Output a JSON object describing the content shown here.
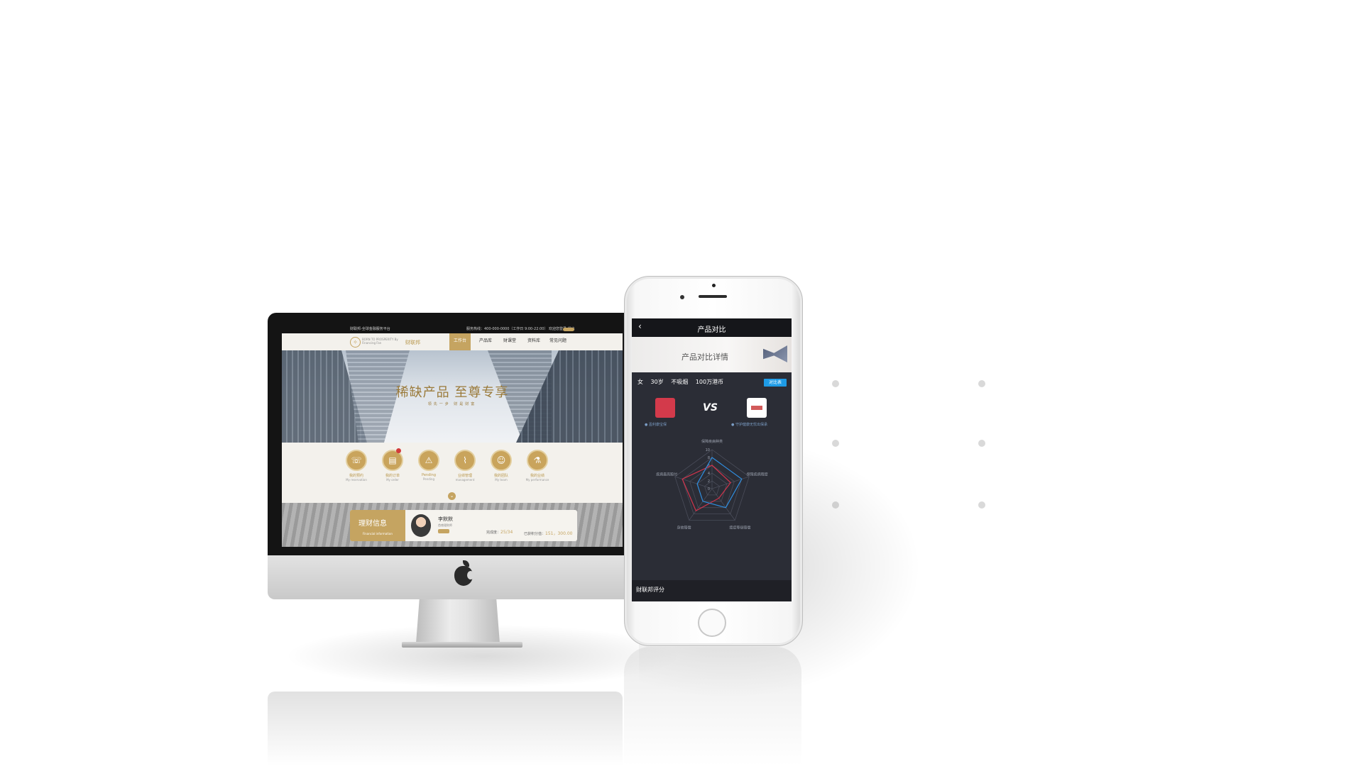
{
  "desktop_site": {
    "topbar": {
      "left_text": "财联邦-全球金融服务平台",
      "right_text": "服务热线：400-000-0000（工作日 9:00-22:00）   欢迎您登录   退出"
    },
    "brand": {
      "logo_glyph": "✧",
      "subtitle": "BORN TO PROSPERITY By Financing Fan",
      "name": "财联邦"
    },
    "nav": [
      {
        "label": "工作台",
        "active": true
      },
      {
        "label": "产品库",
        "active": false
      },
      {
        "label": "财课堂",
        "active": false
      },
      {
        "label": "资料库",
        "active": false
      },
      {
        "label": "常见问题",
        "active": false
      }
    ],
    "hero": {
      "title": "稀缺产品 至尊专享",
      "subtitle": "领先一步 财是财富"
    },
    "shortcuts": [
      {
        "icon": "reservation-icon",
        "glyph": "☏",
        "label": "我的预约",
        "sub": "My reservation"
      },
      {
        "icon": "order-icon",
        "glyph": "▤",
        "label": "我的订单",
        "sub": "My order"
      },
      {
        "icon": "warning-icon",
        "glyph": "⚠",
        "label": "Pending",
        "sub": "Pending"
      },
      {
        "icon": "chart-icon",
        "glyph": "⌇",
        "label": "业绩管理",
        "sub": "management"
      },
      {
        "icon": "team-icon",
        "glyph": "☺",
        "label": "我的团队",
        "sub": "My team"
      },
      {
        "icon": "performance-icon",
        "glyph": "⚗",
        "label": "我的业绩",
        "sub": "My performance"
      }
    ],
    "info_card": {
      "title": "理财信息",
      "title_en": "Financial information",
      "name": "李默默",
      "role": "首席理财师",
      "stat1_label": "完成度：",
      "stat1_value": "25/34",
      "stat2_label": "已获积分值：",
      "stat2_value": "151，300.00"
    }
  },
  "mobile_app": {
    "header": {
      "back": "‹",
      "title": "产品对比"
    },
    "banner": "产品对比详情",
    "filters": [
      "女",
      "30岁",
      "不吸烟",
      "100万港币"
    ],
    "compare_button": "对比表",
    "vs": "VS",
    "product_a": "● 盈利康宝保",
    "product_b": "● 守护健康无忧出保承",
    "score_title": "财联邦评分",
    "colors": {
      "series_a": "#d0344c",
      "series_b": "#2f8ee0"
    }
  },
  "chart_data": {
    "type": "radar",
    "categories": [
      "保障疾病种类",
      "保障疾病程度",
      "癌症等级赔偿",
      "身故赔偿",
      "疾病最高赔付"
    ],
    "ticks": [
      0,
      2,
      4,
      6,
      8,
      10
    ],
    "rlim": [
      0,
      10
    ],
    "series": [
      {
        "values": [
          6,
          5,
          3,
          7,
          8
        ]
      },
      {
        "values": [
          8,
          8,
          6,
          4,
          4
        ]
      }
    ]
  }
}
